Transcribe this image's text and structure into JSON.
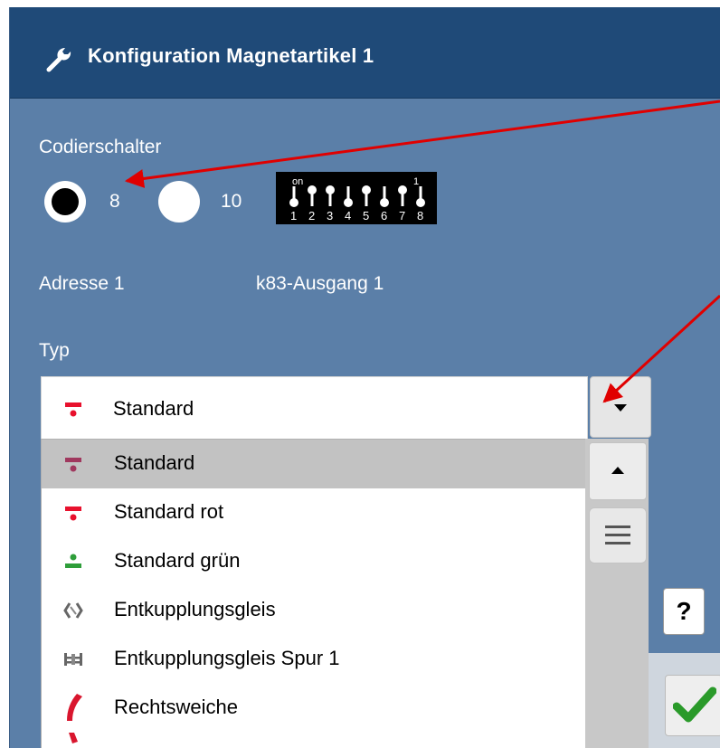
{
  "header": {
    "title": "Konfiguration Magnetartikel 1",
    "icon": "wrench-icon"
  },
  "codierschalter": {
    "label": "Codierschalter",
    "options": [
      {
        "label": "8",
        "selected": true
      },
      {
        "label": "10",
        "selected": false
      }
    ],
    "dip": {
      "on_label": "on",
      "top_label": "1",
      "numbers": [
        "1",
        "2",
        "3",
        "4",
        "5",
        "6",
        "7",
        "8"
      ]
    }
  },
  "address": {
    "label": "Adresse 1",
    "output": "k83-Ausgang 1"
  },
  "typ": {
    "label": "Typ",
    "selected_label": "Standard",
    "options": [
      {
        "label": "Standard",
        "icon": "signal-red-icon"
      },
      {
        "label": "Standard rot",
        "icon": "signal-red-icon"
      },
      {
        "label": "Standard grün",
        "icon": "signal-green-icon"
      },
      {
        "label": "Entkupplungsgleis",
        "icon": "uncoupler-icon"
      },
      {
        "label": "Entkupplungsgleis Spur 1",
        "icon": "uncoupler-track-icon"
      },
      {
        "label": "Rechtsweiche",
        "icon": "right-switch-icon"
      }
    ]
  },
  "help": {
    "label": "?"
  },
  "colors": {
    "header": "#1f4a78",
    "panel": "#5b7fa8",
    "accent_red": "#e8112d",
    "accent_green": "#2e9e3a",
    "annotation": "#e00000"
  }
}
